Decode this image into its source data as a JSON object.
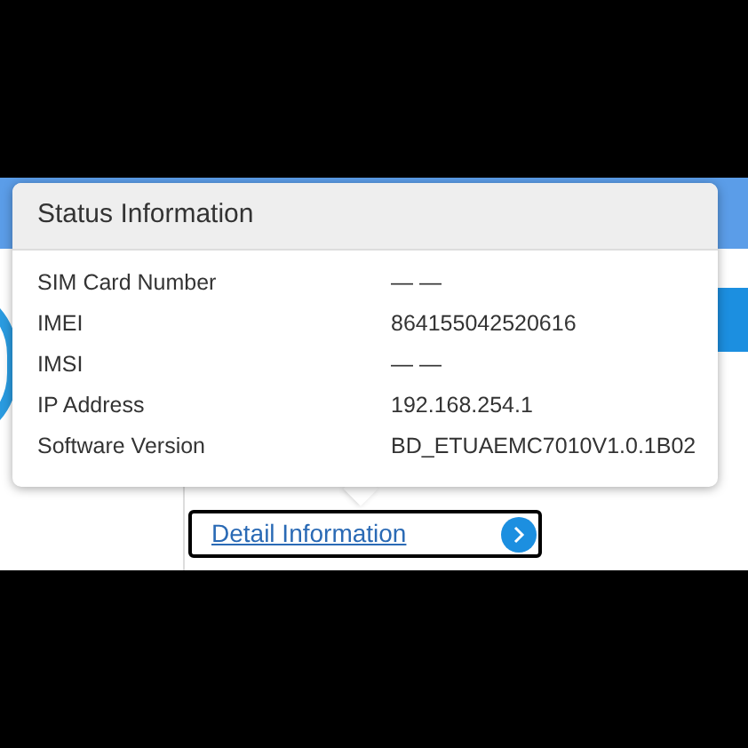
{
  "popup": {
    "title": "Status Information",
    "rows": [
      {
        "label": "SIM Card Number",
        "value": "— —"
      },
      {
        "label": "IMEI",
        "value": "864155042520616"
      },
      {
        "label": "IMSI",
        "value": "— —"
      },
      {
        "label": "IP Address",
        "value": "192.168.254.1"
      },
      {
        "label": "Software Version",
        "value": "BD_ETUAEMC7010V1.0.1B02"
      }
    ]
  },
  "detail_link": {
    "label": "Detail Information"
  }
}
